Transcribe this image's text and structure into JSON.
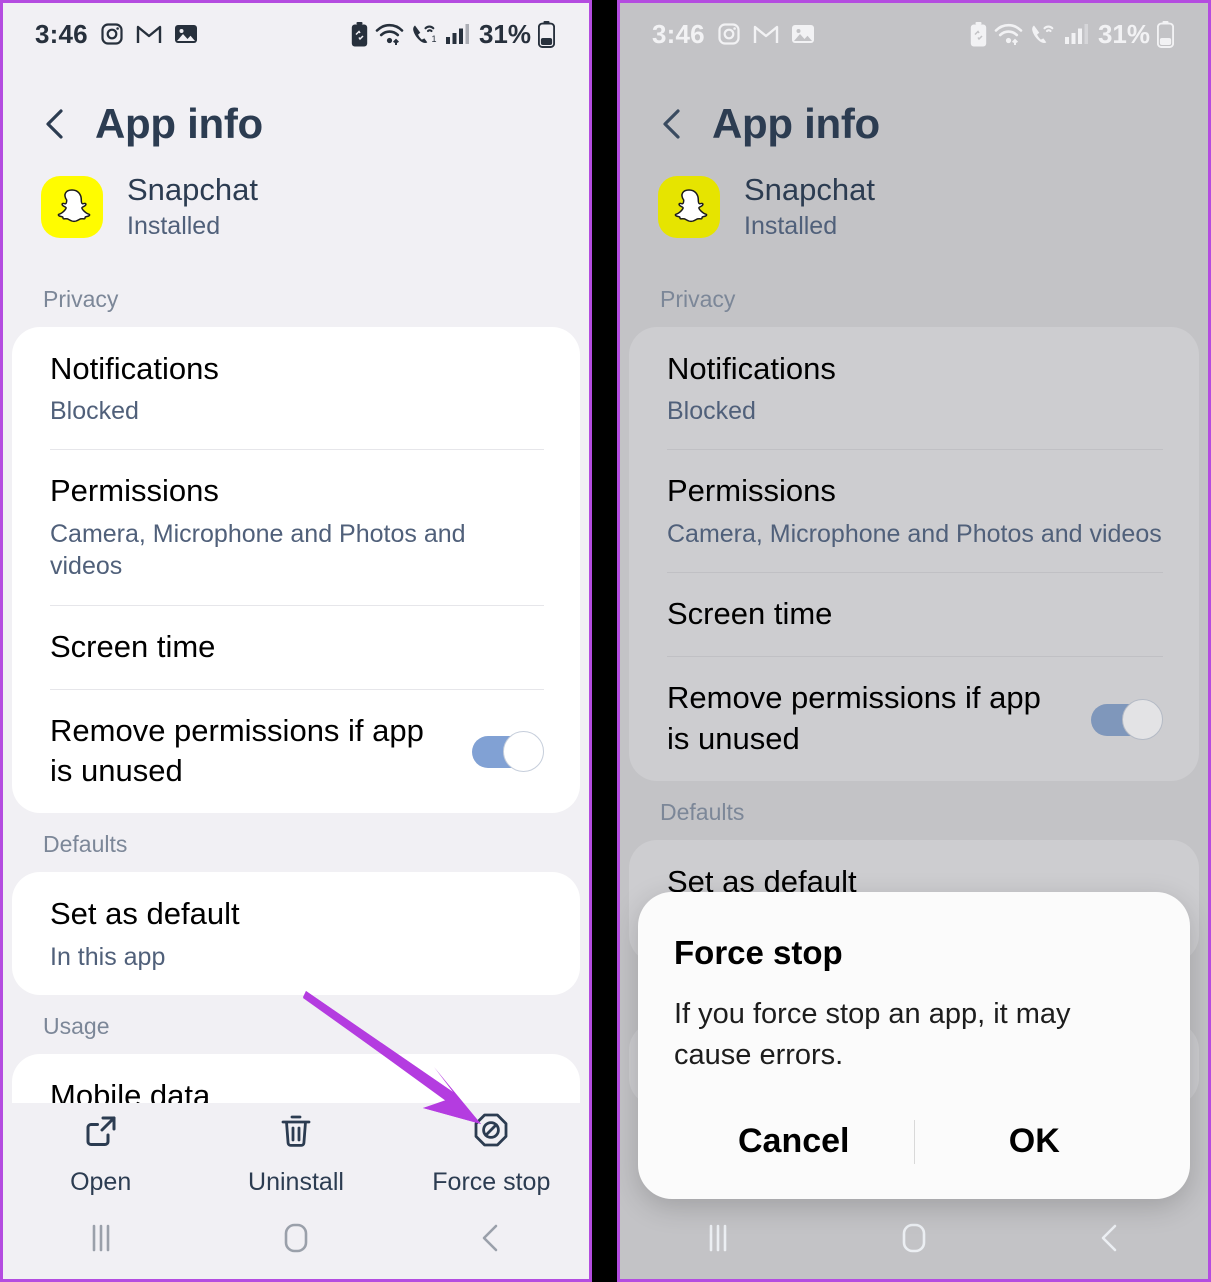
{
  "status_bar": {
    "time": "3:46",
    "left_icons": [
      "instagram-icon",
      "gmail-icon",
      "photos-icon"
    ],
    "right_icons": [
      "battery-saver-icon",
      "wifi-icon",
      "wifi-calling-icon",
      "signal-bars-icon"
    ],
    "battery_percent": "31%"
  },
  "header": {
    "title": "App info",
    "back_icon": "chevron-left-icon"
  },
  "app": {
    "name": "Snapchat",
    "status": "Installed",
    "icon": "snapchat-icon",
    "icon_color": "#fffc00"
  },
  "sections": [
    {
      "label": "Privacy",
      "rows": [
        {
          "title": "Notifications",
          "sub": "Blocked"
        },
        {
          "title": "Permissions",
          "sub": "Camera, Microphone and Photos and videos"
        },
        {
          "title": "Screen time",
          "sub": ""
        },
        {
          "title": "Remove permissions if app is unused",
          "sub": "",
          "toggle": "on"
        }
      ]
    },
    {
      "label": "Defaults",
      "rows": [
        {
          "title": "Set as default",
          "sub": "In this app"
        }
      ]
    },
    {
      "label": "Usage",
      "rows": [
        {
          "title": "Mobile data",
          "sub": ""
        }
      ]
    }
  ],
  "bottom_actions": [
    {
      "label": "Open",
      "icon": "open-external-icon"
    },
    {
      "label": "Uninstall",
      "icon": "trash-icon"
    },
    {
      "label": "Force stop",
      "icon": "force-stop-icon"
    }
  ],
  "nav_bar": [
    {
      "icon": "recents-icon"
    },
    {
      "icon": "home-icon"
    },
    {
      "icon": "back-icon"
    }
  ],
  "dialog": {
    "title": "Force stop",
    "message": "If you force stop an app, it may cause errors.",
    "cancel_label": "Cancel",
    "ok_label": "OK"
  },
  "annotation": {
    "arrow_color": "#b43ce0"
  },
  "toggle_color": "#81a1d4"
}
